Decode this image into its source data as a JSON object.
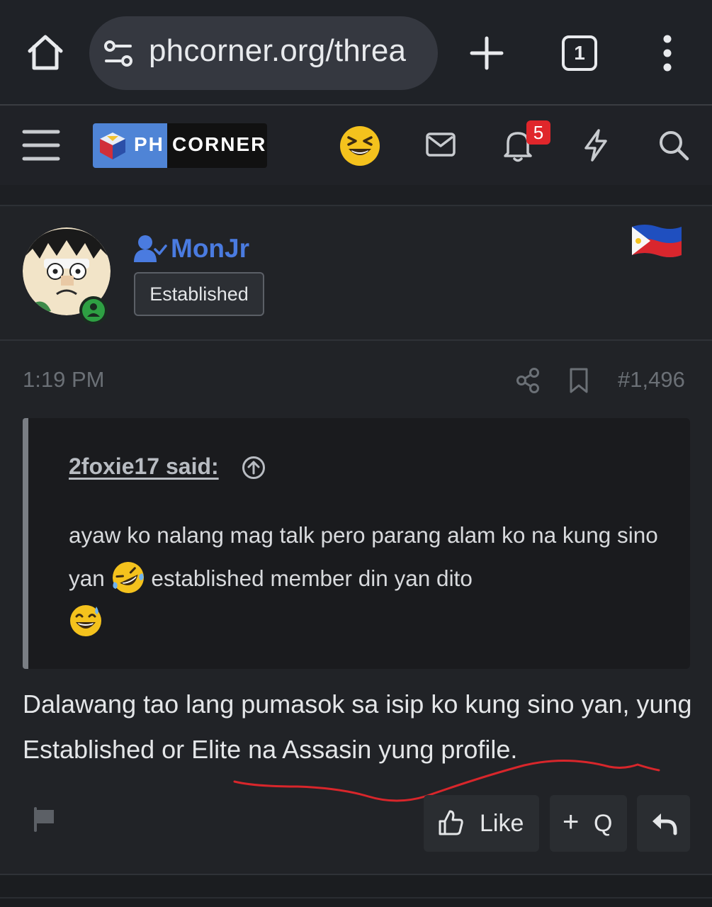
{
  "browser": {
    "url": "phcorner.org/threa",
    "tab_count": "1",
    "icons": [
      "home-icon",
      "site-info-icon",
      "new-tab-icon",
      "tab-switcher-icon",
      "more-menu-icon"
    ]
  },
  "site_header": {
    "logo_ph": "PH",
    "logo_corner": "CORNER",
    "notification_count": "5",
    "icons": [
      "hamburger-icon",
      "laughing-emoji-icon",
      "mail-icon",
      "bell-icon",
      "bolt-icon",
      "search-icon"
    ],
    "colors": {
      "logo_blue": "#4f84d6",
      "badge_red": "#e0262b"
    }
  },
  "user": {
    "name": "MonJr",
    "rank": "Established",
    "status": "online",
    "flag": "philippines-flag-icon",
    "colors": {
      "username": "#4a7be0"
    }
  },
  "post": {
    "time": "1:19 PM",
    "number": "#1,496",
    "quote": {
      "author": "2foxie17 said:",
      "text_part1": "ayaw ko nalang mag talk pero parang alam ko na kung sino yan",
      "text_part2": "established member din yan dito",
      "emojis": [
        "rofl-emoji",
        "grinning-sweat-emoji"
      ]
    },
    "body": "Dalawang tao lang pumasok sa isip ko kung sino yan, yung Established or Elite na Assasin yung profile.",
    "annotation_color": "#d8262b"
  },
  "actions": {
    "like_label": "Like",
    "quote_plus": "+",
    "quote_label": "Q"
  }
}
